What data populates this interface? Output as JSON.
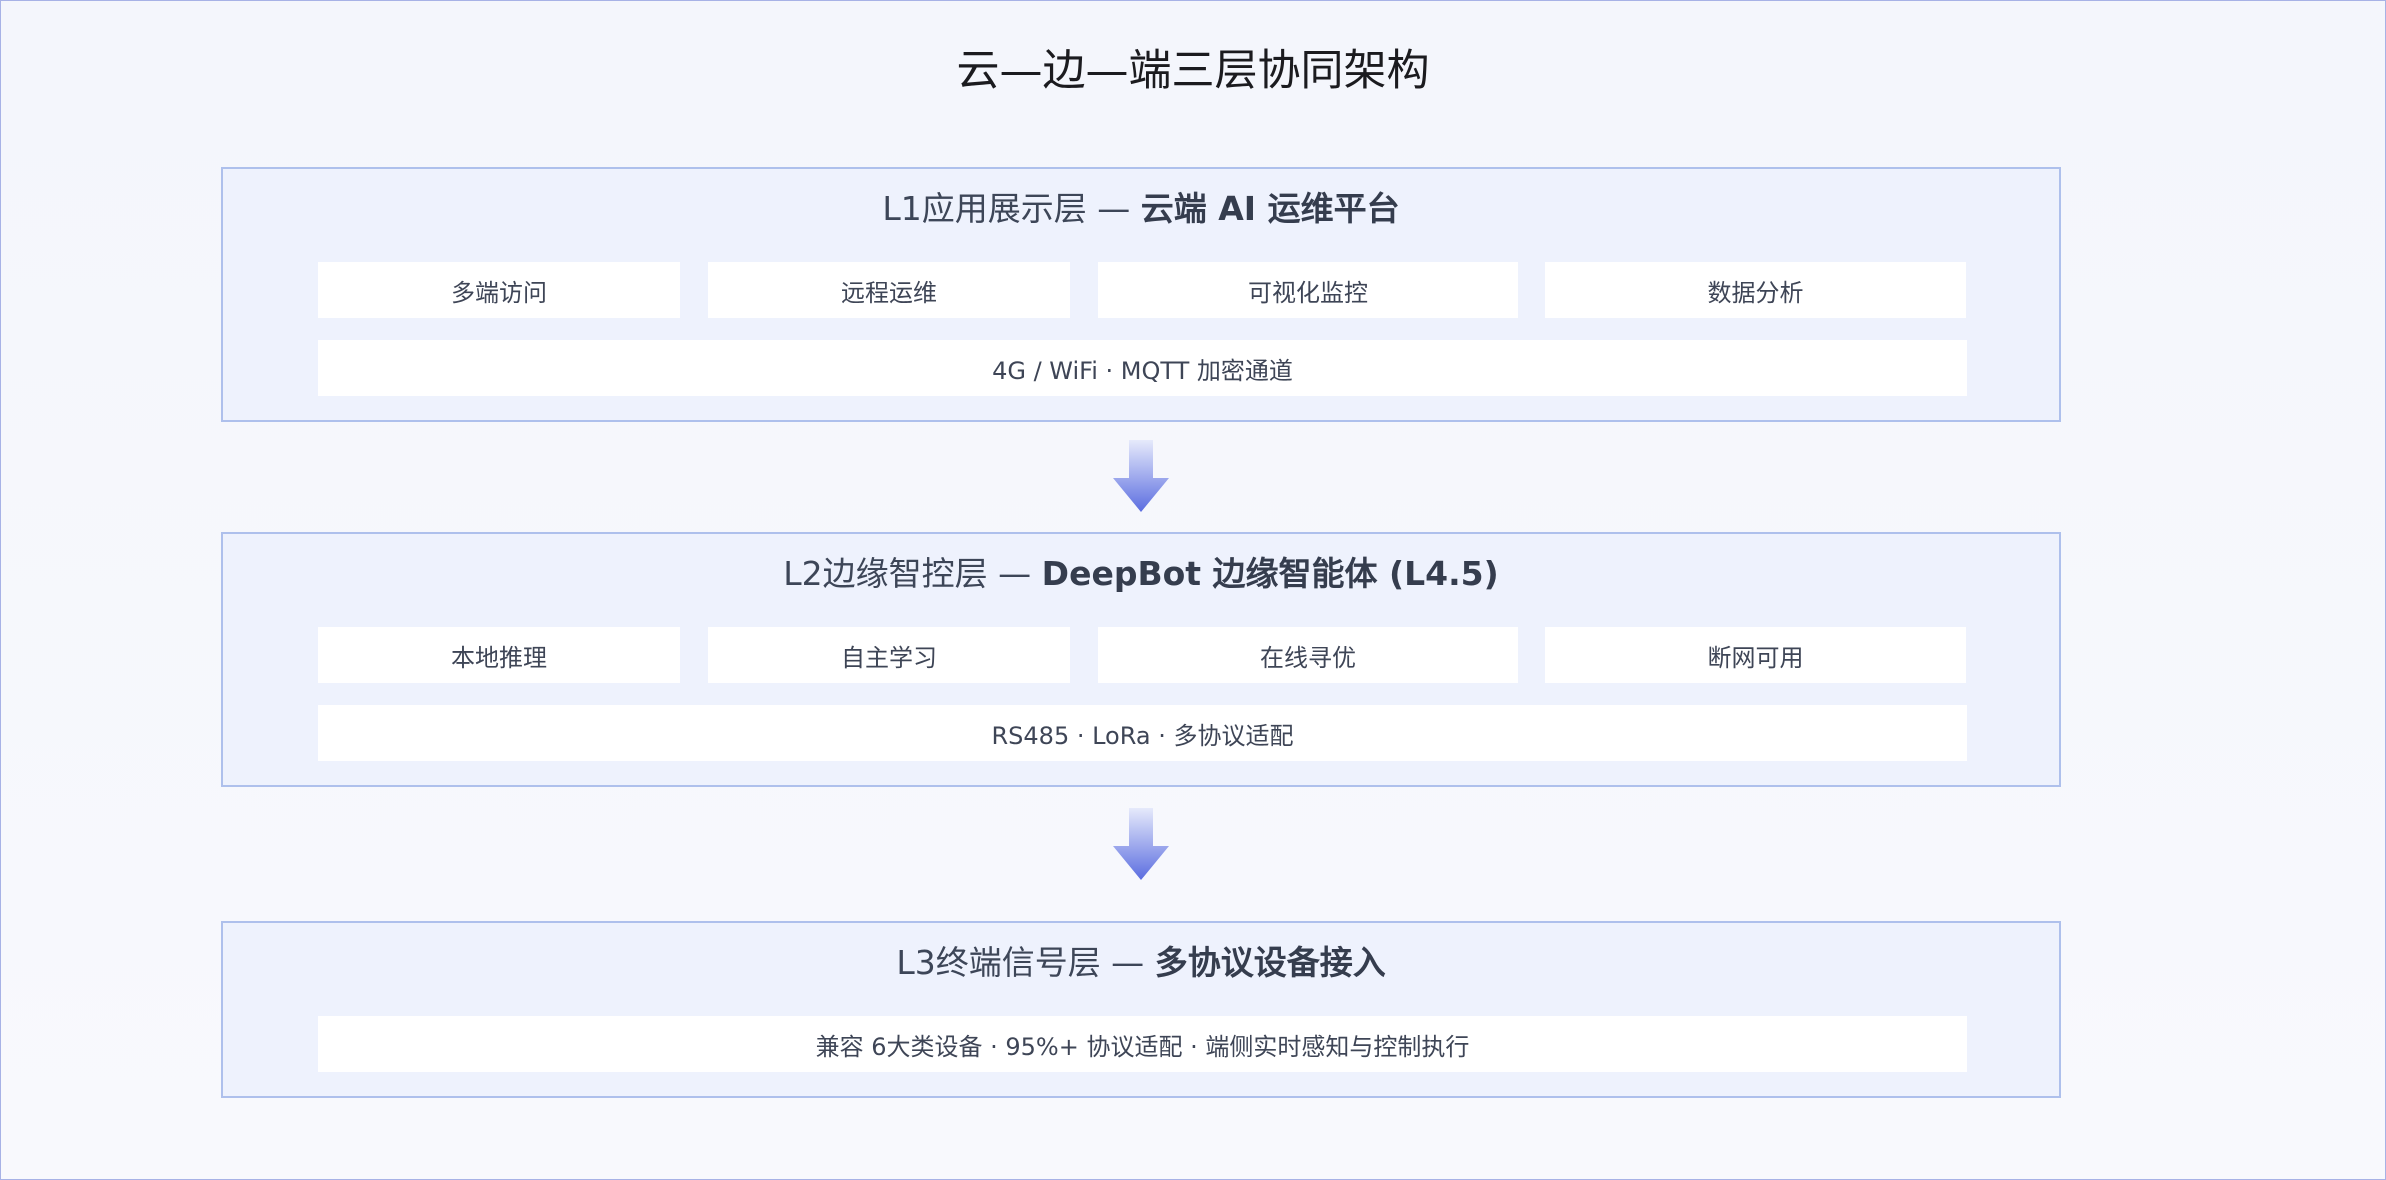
{
  "title": "云—边—端三层协同架构",
  "layers": [
    {
      "label": "L1应用展示层 — ",
      "highlight": "云端 AI 运维平台",
      "items": [
        "多端访问",
        "远程运维",
        "可视化监控",
        "数据分析"
      ],
      "bar": "4G  / WiFi · MQTT 加密通道"
    },
    {
      "label": "L2边缘智控层 — ",
      "highlight": "DeepBot 边缘智能体 (L4.5)",
      "items": [
        "本地推理",
        "自主学习",
        "在线寻优",
        "断网可用"
      ],
      "bar": "RS485 · LoRa · 多协议适配"
    },
    {
      "label": "L3终端信号层 — ",
      "highlight": "多协议设备接入",
      "items": [],
      "bar": "兼容 6大类设备 · 95%+ 协议适配 · 端侧实时感知与控制执行"
    }
  ],
  "colors": {
    "arrow_top": "#e6eafb",
    "arrow_bottom": "#5b6de0",
    "layer_border": "#aec0ec",
    "layer_bg": "#eef2fd"
  }
}
